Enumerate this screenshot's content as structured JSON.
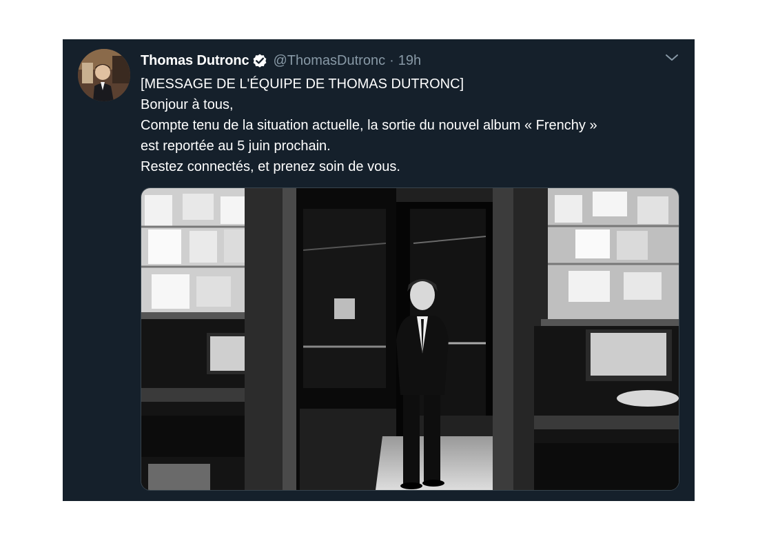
{
  "tweet": {
    "author": {
      "display_name": "Thomas Dutronc",
      "handle": "@ThomasDutronc",
      "verified": true,
      "verified_icon": "verified-badge-icon",
      "avatar_icon": "avatar"
    },
    "separator": "·",
    "time": "19h",
    "menu_icon": "chevron-down-icon",
    "text_lines": [
      "[MESSAGE DE L'ÉQUIPE DE THOMAS DUTRONC]",
      "Bonjour à tous,",
      "Compte tenu de la situation actuelle, la sortie du nouvel album « Frenchy »",
      "est reportée au 5 juin prochain.",
      "Restez connectés, et prenez soin de vous."
    ],
    "media": {
      "type": "photo",
      "style": "black-and-white"
    }
  },
  "colors": {
    "background": "#15202b",
    "primary_text": "#ffffff",
    "secondary_text": "#8899a6",
    "verified_badge": "#ffffff",
    "page": "#ffffff"
  }
}
